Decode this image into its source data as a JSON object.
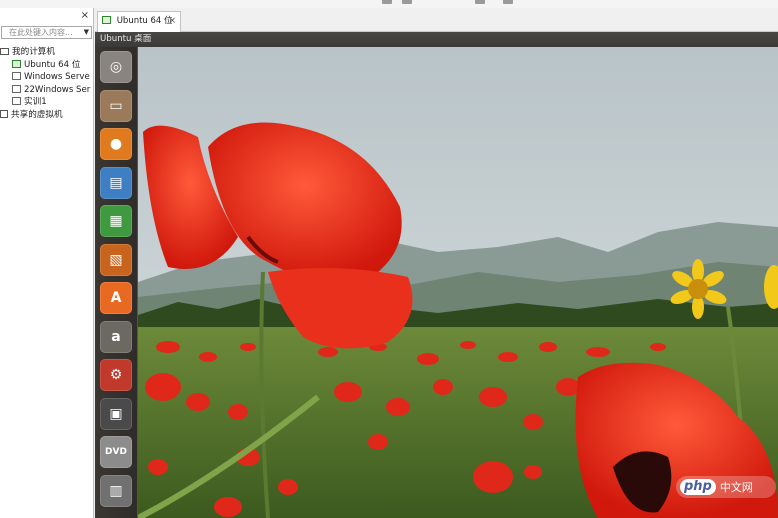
{
  "library": {
    "close_label": "×",
    "search_placeholder": "在此处键入内容...",
    "tree": [
      {
        "label": "我的计算机",
        "level": 0,
        "icon": "computer-icon"
      },
      {
        "label": "Ubuntu 64 位",
        "level": 1,
        "icon": "vm-running-icon"
      },
      {
        "label": "Windows Serve",
        "level": 1,
        "icon": "vm-icon"
      },
      {
        "label": "22Windows Ser",
        "level": 1,
        "icon": "vm-icon"
      },
      {
        "label": "实训1",
        "level": 1,
        "icon": "vm-icon"
      },
      {
        "label": "共享的虚拟机",
        "level": 0,
        "icon": "shared-vm-icon"
      }
    ]
  },
  "tabs": [
    {
      "label": "Ubuntu 64 位",
      "close": "×",
      "active": true
    }
  ],
  "vm": {
    "title": "Ubuntu 桌面"
  },
  "launcher": {
    "items": [
      {
        "name": "dash-home-icon",
        "glyph": "◎",
        "color": "#8a8480"
      },
      {
        "name": "files-icon",
        "glyph": "▭",
        "color": "#9a7a5a"
      },
      {
        "name": "firefox-icon",
        "glyph": "●",
        "color": "#e07a1e"
      },
      {
        "name": "libreoffice-writer-icon",
        "glyph": "▤",
        "color": "#3d7fc2"
      },
      {
        "name": "libreoffice-calc-icon",
        "glyph": "▦",
        "color": "#3f9a3f"
      },
      {
        "name": "libreoffice-impress-icon",
        "glyph": "▧",
        "color": "#c8641e"
      },
      {
        "name": "software-center-icon",
        "glyph": "A",
        "color": "#e86a22"
      },
      {
        "name": "amazon-icon",
        "glyph": "a",
        "color": "#6c6862"
      },
      {
        "name": "system-settings-icon",
        "glyph": "⚙",
        "color": "#c0392b"
      },
      {
        "name": "save-disk-icon",
        "glyph": "▣",
        "color": "#4a4a4a"
      },
      {
        "name": "dvd-icon",
        "glyph": "DVD",
        "color": "#8c8c8c"
      },
      {
        "name": "trash-icon",
        "glyph": "▥",
        "color": "#707070"
      }
    ]
  },
  "watermark": {
    "brand": "php",
    "suffix": "中文网"
  }
}
